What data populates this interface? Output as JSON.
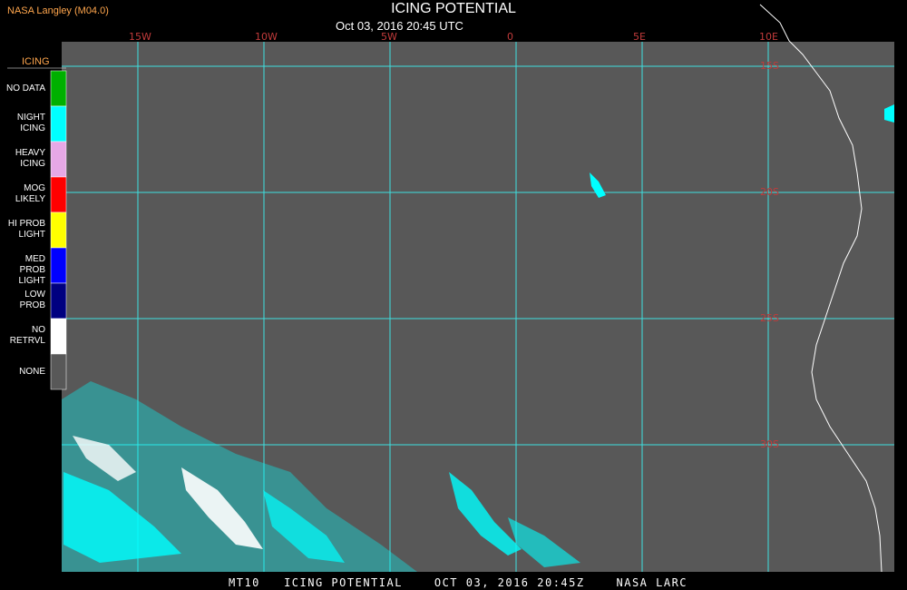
{
  "header": {
    "source": "NASA Langley (M04.0)",
    "title": "ICING POTENTIAL",
    "timestamp": "Oct 03, 2016 20:45 UTC"
  },
  "map": {
    "background_color": "#585858",
    "grid_color": "#3ee0e0",
    "longitude_labels": [
      "15W",
      "10W",
      "5W",
      "0",
      "5E",
      "10E"
    ],
    "latitude_labels": [
      "15S",
      "20S",
      "25S",
      "30S"
    ],
    "label_color": "#c23b3b"
  },
  "legend": {
    "title": "ICING",
    "items": [
      {
        "label": "NO DATA",
        "color": "#00b000"
      },
      {
        "label": "NIGHT ICING",
        "color": "#00ffff"
      },
      {
        "label": "HEAVY ICING",
        "color": "#e6a8e6"
      },
      {
        "label": "MOG LIKELY",
        "color": "#ff0000"
      },
      {
        "label": "HI PROB LIGHT",
        "color": "#ffff00"
      },
      {
        "label": "MED PROB LIGHT",
        "color": "#0000ff"
      },
      {
        "label": "LOW PROB",
        "color": "#000080"
      },
      {
        "label": "NO RETRVL",
        "color": "#ffffff"
      },
      {
        "label": "NONE",
        "color": "#585858"
      }
    ]
  },
  "footer": {
    "text": "MT10   ICING POTENTIAL    OCT 03, 2016 20:45Z    NASA LARC"
  }
}
